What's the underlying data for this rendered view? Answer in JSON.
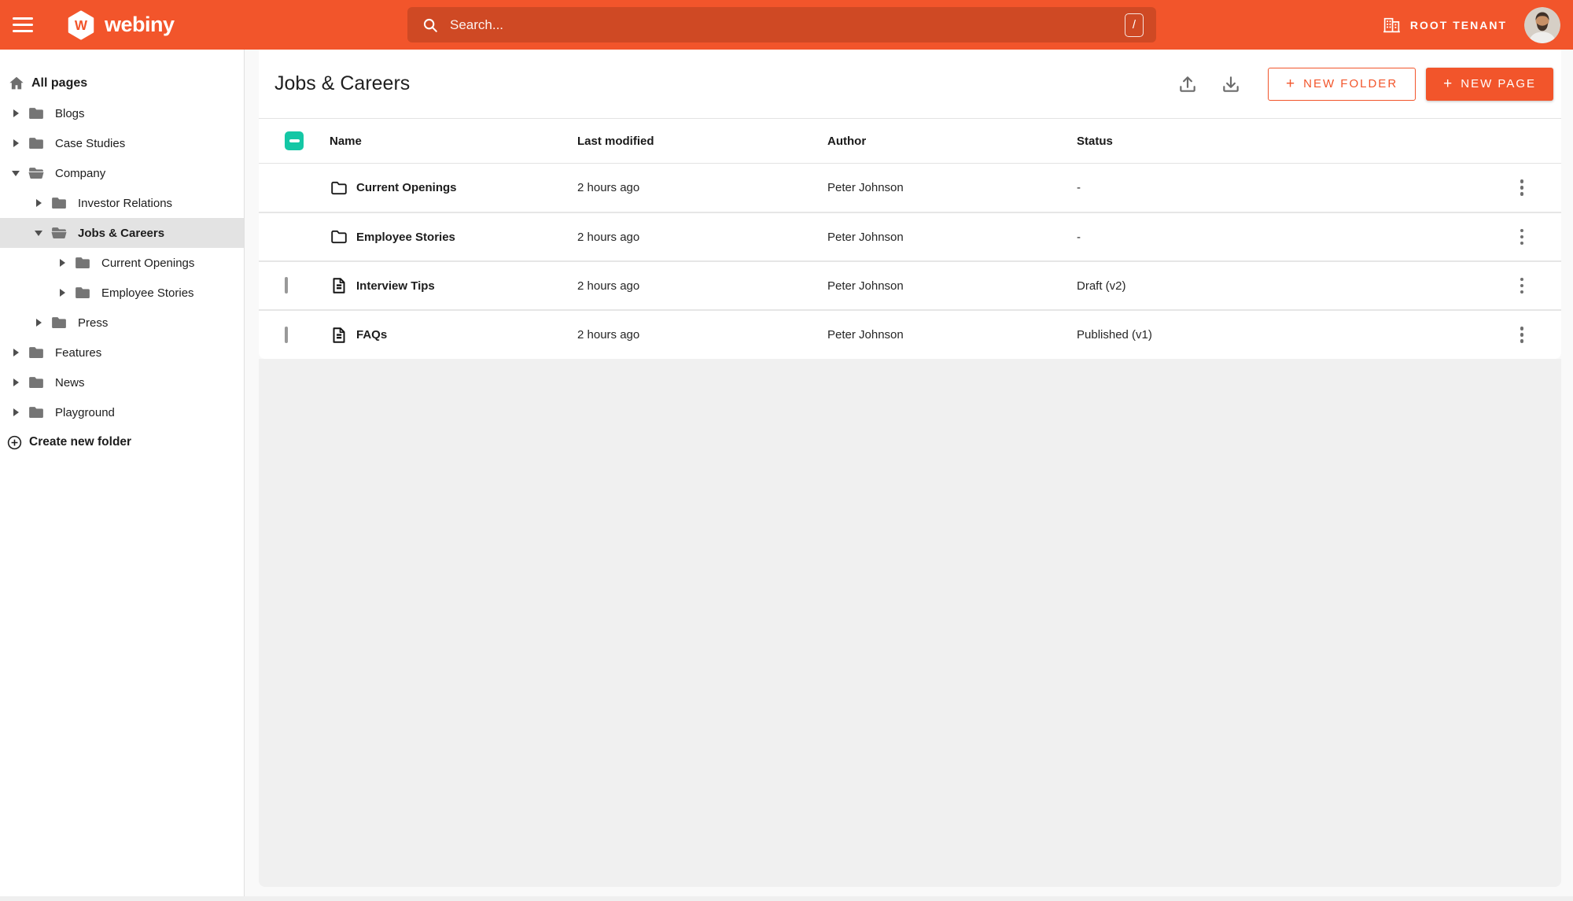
{
  "topbar": {
    "brand": "webiny",
    "search": {
      "placeholder": "Search...",
      "shortcut": "/"
    },
    "tenant": "ROOT TENANT"
  },
  "sidebar": {
    "root_label": "All pages",
    "items": [
      {
        "label": "Blogs",
        "level": 0,
        "state": "collapsed",
        "selected": false
      },
      {
        "label": "Case Studies",
        "level": 0,
        "state": "collapsed",
        "selected": false
      },
      {
        "label": "Company",
        "level": 0,
        "state": "expanded",
        "selected": false
      },
      {
        "label": "Investor Relations",
        "level": 1,
        "state": "collapsed",
        "selected": false
      },
      {
        "label": "Jobs & Careers",
        "level": 1,
        "state": "expanded",
        "selected": true
      },
      {
        "label": "Current Openings",
        "level": 2,
        "state": "collapsed",
        "selected": false
      },
      {
        "label": "Employee Stories",
        "level": 2,
        "state": "collapsed",
        "selected": false
      },
      {
        "label": "Press",
        "level": 1,
        "state": "collapsed",
        "selected": false
      },
      {
        "label": "Features",
        "level": 0,
        "state": "collapsed",
        "selected": false
      },
      {
        "label": "News",
        "level": 0,
        "state": "collapsed",
        "selected": false
      },
      {
        "label": "Playground",
        "level": 0,
        "state": "collapsed",
        "selected": false
      }
    ],
    "create_folder_label": "Create new folder"
  },
  "main": {
    "title": "Jobs & Careers",
    "buttons": {
      "new_folder": "NEW FOLDER",
      "new_page": "NEW PAGE",
      "plus": "+"
    },
    "table": {
      "columns": [
        "Name",
        "Last modified",
        "Author",
        "Status"
      ],
      "rows": [
        {
          "type": "folder",
          "name": "Current Openings",
          "modified": "2 hours ago",
          "author": "Peter Johnson",
          "status": "-",
          "has_checkbox": false
        },
        {
          "type": "folder",
          "name": "Employee Stories",
          "modified": "2 hours ago",
          "author": "Peter Johnson",
          "status": "-",
          "has_checkbox": false
        },
        {
          "type": "page",
          "name": "Interview Tips",
          "modified": "2 hours ago",
          "author": "Peter Johnson",
          "status": "Draft (v2)",
          "has_checkbox": true
        },
        {
          "type": "page",
          "name": "FAQs",
          "modified": "2 hours ago",
          "author": "Peter Johnson",
          "status": "Published (v1)",
          "has_checkbox": true
        }
      ]
    }
  },
  "colors": {
    "primary_orange": "#f2552b",
    "teal_checkbox": "#14c7a5",
    "selected_row_gray": "#e3e3e3"
  },
  "icons": [
    "hamburger-icon",
    "webiny-logo",
    "search-icon",
    "slash-key",
    "tenant-building-icon",
    "avatar",
    "home-icon",
    "caret-right-icon",
    "caret-down-icon",
    "folder-icon",
    "folder-open-icon",
    "circle-plus-icon",
    "upload-icon",
    "download-icon",
    "checkbox-indeterminate",
    "checkbox-unchecked",
    "folder-outline-icon",
    "document-icon",
    "kebab-icon"
  ]
}
